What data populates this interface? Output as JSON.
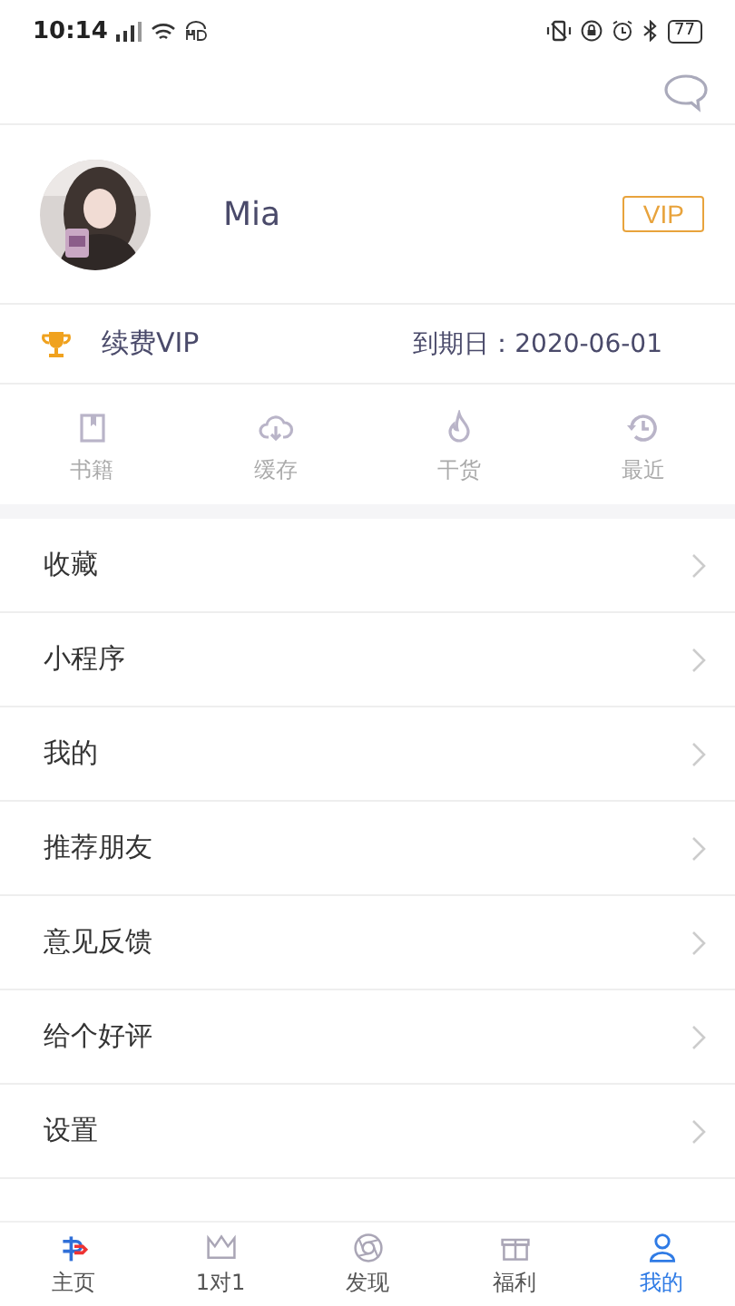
{
  "status_bar": {
    "time": "10:14",
    "battery": "77"
  },
  "profile": {
    "name": "Mia",
    "badge": "VIP"
  },
  "vip": {
    "label": "续费VIP",
    "expiry": "到期日：2020-06-01"
  },
  "shortcuts": [
    {
      "label": "书籍",
      "kind": "book"
    },
    {
      "label": "缓存",
      "kind": "cloud"
    },
    {
      "label": "干货",
      "kind": "flame"
    },
    {
      "label": "最近",
      "kind": "history"
    }
  ],
  "menu": [
    {
      "label": "收藏"
    },
    {
      "label": "小程序"
    },
    {
      "label": "我的"
    },
    {
      "label": "推荐朋友"
    },
    {
      "label": "意见反馈"
    },
    {
      "label": "给个好评"
    },
    {
      "label": "设置"
    }
  ],
  "tabs": [
    {
      "label": "主页",
      "kind": "home",
      "selected": false
    },
    {
      "label": "1对1",
      "kind": "crown",
      "selected": false
    },
    {
      "label": "发现",
      "kind": "aperture",
      "selected": false
    },
    {
      "label": "福利",
      "kind": "gift",
      "selected": false
    },
    {
      "label": "我的",
      "kind": "person",
      "selected": true
    }
  ]
}
